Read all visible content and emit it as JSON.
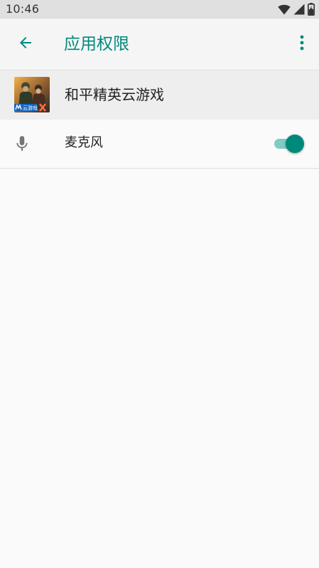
{
  "status_bar": {
    "time": "10:46",
    "icons": [
      "wifi-icon",
      "cellular-signal-icon",
      "battery-icon"
    ]
  },
  "app_bar": {
    "title": "应用权限",
    "back_icon": "arrow-back-icon",
    "menu_icon": "more-vert-icon"
  },
  "app": {
    "name": "和平精英云游戏",
    "icon_badge": "云游戏"
  },
  "permissions": [
    {
      "label": "麦克风",
      "icon": "microphone-icon",
      "enabled": true
    }
  ],
  "colors": {
    "accent": "#00897b",
    "accent_light": "#80cbc4",
    "status_bar_bg": "#e0e0e0",
    "app_bar_bg": "#f5f5f5",
    "page_bg": "#fafafa"
  }
}
